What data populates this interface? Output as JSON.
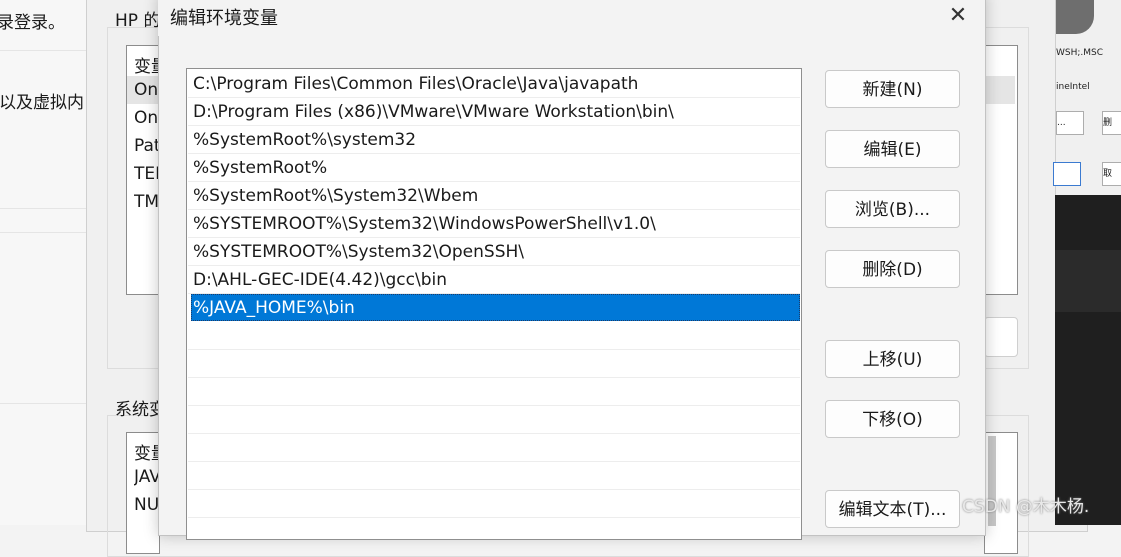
{
  "settings_page": {
    "line1": "录登录。",
    "line2": "以及虚拟内"
  },
  "env_window": {
    "user_group_title": "HP 的",
    "list_header": "变量",
    "rows": [
      "On",
      "On",
      "Pat",
      "TEI",
      "TM"
    ],
    "system_group_title": "系统变",
    "system_header": "变量",
    "system_rows": [
      "JAV",
      "NU"
    ]
  },
  "sys_props_window": {
    "text1": "WSH;.MSC",
    "text2": "ineIntel",
    "btn1": "...",
    "btn2": "删",
    "btn3": "取"
  },
  "dialog": {
    "title": "编辑环境变量",
    "close_glyph": "✕",
    "paths": [
      "C:\\Program Files\\Common Files\\Oracle\\Java\\javapath",
      "D:\\Program Files (x86)\\VMware\\VMware Workstation\\bin\\",
      "%SystemRoot%\\system32",
      "%SystemRoot%",
      "%SystemRoot%\\System32\\Wbem",
      "%SYSTEMROOT%\\System32\\WindowsPowerShell\\v1.0\\",
      "%SYSTEMROOT%\\System32\\OpenSSH\\",
      "D:\\AHL-GEC-IDE(4.42)\\gcc\\bin",
      "%JAVA_HOME%\\bin"
    ],
    "selected_index": 8,
    "buttons": {
      "new": "新建(N)",
      "edit": "编辑(E)",
      "browse": "浏览(B)...",
      "delete": "删除(D)",
      "move_up": "上移(U)",
      "move_down": "下移(O)",
      "edit_text": "编辑文本(T)..."
    }
  },
  "watermark": "CSDN @木木杨.",
  "colors": {
    "selection": "#0078d7",
    "dialog_bg": "#f3f3f3",
    "button_bg": "#fdfdfd"
  }
}
